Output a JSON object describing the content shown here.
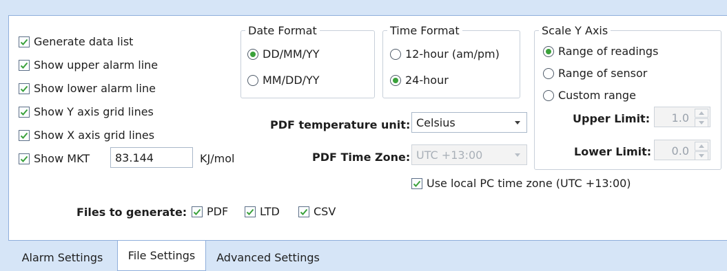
{
  "options": {
    "generate_data_list": "Generate data list",
    "show_upper_alarm": "Show upper alarm line",
    "show_lower_alarm": "Show lower alarm line",
    "show_y_grid": "Show Y axis grid lines",
    "show_x_grid": "Show X axis grid lines",
    "show_mkt": "Show MKT",
    "mkt_value": "83.144",
    "mkt_unit": "KJ/mol"
  },
  "date_format": {
    "legend": "Date Format",
    "opt1": "DD/MM/YY",
    "opt2": "MM/DD/YY",
    "selected": "DD/MM/YY"
  },
  "time_format": {
    "legend": "Time Format",
    "opt1": "12-hour (am/pm)",
    "opt2": "24-hour",
    "selected": "24-hour"
  },
  "scale_y": {
    "legend": "Scale Y Axis",
    "opt1": "Range of readings",
    "opt2": "Range of sensor",
    "opt3": "Custom range",
    "selected": "Range of readings",
    "upper_label": "Upper Limit:",
    "upper_value": "1.0",
    "lower_label": "Lower Limit:",
    "lower_value": "0.0"
  },
  "pdf": {
    "temp_unit_label": "PDF temperature unit:",
    "temp_unit_value": "Celsius",
    "timezone_label": "PDF Time Zone:",
    "timezone_value": "UTC +13:00",
    "use_local_tz": "Use local PC time zone (UTC +13:00)"
  },
  "files": {
    "label": "Files to generate:",
    "pdf": "PDF",
    "ltd": "LTD",
    "csv": "CSV"
  },
  "tabs": [
    "Alarm Settings",
    "File Settings",
    "Advanced Settings"
  ],
  "colors": {
    "check": "#3aa13a",
    "tab_bg": "#d6e5f7",
    "border": "#8eaedb"
  }
}
